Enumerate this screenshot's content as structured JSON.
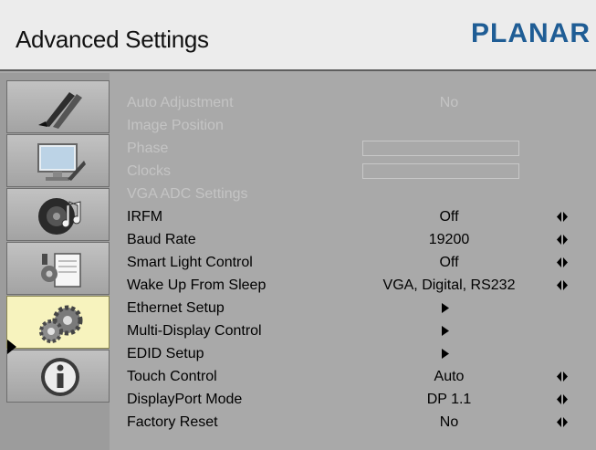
{
  "header": {
    "title": "Advanced Settings",
    "logo": "PLANAR"
  },
  "sidebar": {
    "tabs": [
      {
        "name": "picture",
        "icon": "brushes-icon"
      },
      {
        "name": "display",
        "icon": "monitor-icon"
      },
      {
        "name": "audio",
        "icon": "speaker-icon"
      },
      {
        "name": "tools",
        "icon": "tools-icon"
      },
      {
        "name": "advanced",
        "icon": "gears-icon",
        "active": true
      },
      {
        "name": "information",
        "icon": "info-icon"
      }
    ]
  },
  "menu": {
    "items": [
      {
        "label": "Auto Adjustment",
        "value": "No",
        "enabled": false
      },
      {
        "label": "Image Position",
        "value": "",
        "enabled": false
      },
      {
        "label": "Phase",
        "value": "",
        "enabled": false
      },
      {
        "label": "Clocks",
        "value": "",
        "enabled": false
      },
      {
        "label": "VGA ADC Settings",
        "value": "",
        "enabled": false
      },
      {
        "label": "IRFM",
        "value": "Off",
        "enabled": true
      },
      {
        "label": "Baud Rate",
        "value": "19200",
        "enabled": true
      },
      {
        "label": "Smart Light Control",
        "value": "Off",
        "enabled": true
      },
      {
        "label": "Wake Up From Sleep",
        "value": "VGA, Digital, RS232",
        "enabled": true
      },
      {
        "label": "Ethernet Setup",
        "value": "",
        "enabled": true
      },
      {
        "label": "Multi-Display Control",
        "value": "",
        "enabled": true
      },
      {
        "label": "EDID Setup",
        "value": "",
        "enabled": true
      },
      {
        "label": "Touch Control",
        "value": "Auto",
        "enabled": true
      },
      {
        "label": "DisplayPort Mode",
        "value": "DP 1.1",
        "enabled": true
      },
      {
        "label": "Factory Reset",
        "value": "No",
        "enabled": true
      }
    ]
  },
  "colors": {
    "logo": "#1f5d95",
    "active_tab": "#f7f3be",
    "background": "#a9a9a9",
    "disabled_text": "#c4c4c4"
  }
}
